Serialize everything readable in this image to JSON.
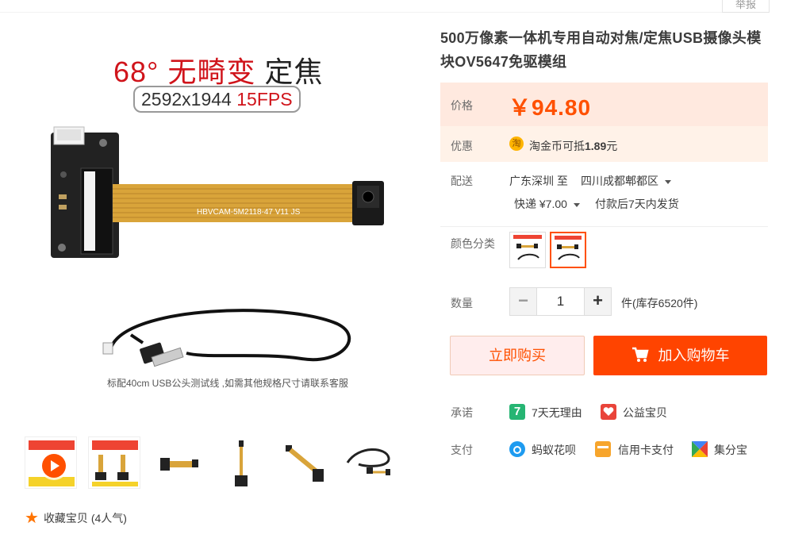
{
  "report_label": "举报",
  "hero": {
    "title_red": "68°  无畸变",
    "title_dark": "定焦",
    "spec_plain": "2592x1944",
    "spec_red": "15FPS",
    "board_print": "HBVCAM-5M2118-47  V11  JS",
    "caption": "标配40cm USB公头测试线 ,如需其他规格尺寸请联系客服"
  },
  "favorite": {
    "label": "收藏宝贝",
    "count": "(4人气)"
  },
  "product": {
    "title": "500万像素一体机专用自动对焦/定焦USB摄像头模块OV5647免驱模组"
  },
  "price": {
    "label": "价格",
    "value": "￥94.80"
  },
  "promo": {
    "label": "优惠",
    "icon_char": "淘",
    "text": "淘金币可抵",
    "amount": "1.89",
    "unit": "元"
  },
  "shipping": {
    "label": "配送",
    "from": "广东深圳 至",
    "to": "四川成都郫都区",
    "method": "快递 ¥7.00",
    "dispatch": "付款后7天内发货"
  },
  "color": {
    "label": "颜色分类"
  },
  "quantity": {
    "label": "数量",
    "value": "1",
    "minus": "−",
    "plus": "+",
    "stock": "件(库存6520件)"
  },
  "actions": {
    "buy_now": "立即购买",
    "add_to_cart": "加入购物车"
  },
  "promise": {
    "label": "承诺",
    "items": [
      "7天无理由",
      "公益宝贝"
    ]
  },
  "payment": {
    "label": "支付",
    "items": [
      "蚂蚁花呗",
      "信用卡支付",
      "集分宝"
    ]
  },
  "colors": {
    "accent": "#ff5000",
    "cart_bg": "#ff4400",
    "price_bg": "#fff2e8"
  }
}
